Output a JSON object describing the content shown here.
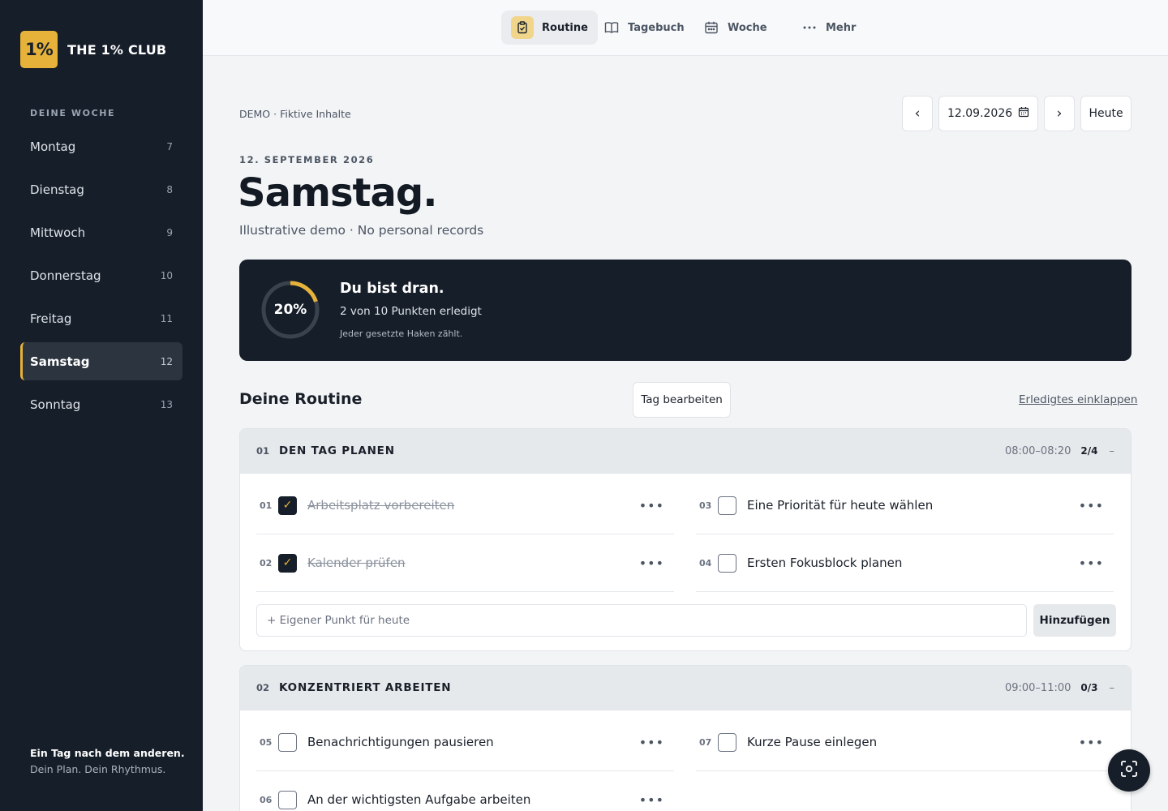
{
  "brand": {
    "logo": "1%",
    "name": "THE 1% CLUB"
  },
  "sidebar": {
    "heading": "DEINE WOCHE",
    "days": [
      {
        "label": "Montag",
        "num": "7"
      },
      {
        "label": "Dienstag",
        "num": "8"
      },
      {
        "label": "Mittwoch",
        "num": "9"
      },
      {
        "label": "Donnerstag",
        "num": "10"
      },
      {
        "label": "Freitag",
        "num": "11"
      },
      {
        "label": "Samstag",
        "num": "12",
        "active": true
      },
      {
        "label": "Sonntag",
        "num": "13"
      }
    ],
    "footer": {
      "line1": "Ein Tag nach dem anderen.",
      "line2": "Dein Plan. Dein Rhythmus."
    }
  },
  "nav": {
    "tabs": [
      {
        "label": "Routine",
        "icon": "clipboard-check-icon",
        "active": true
      },
      {
        "label": "Tagebuch",
        "icon": "book-icon"
      },
      {
        "label": "Woche",
        "icon": "calendar-icon"
      },
      {
        "label": "Mehr",
        "icon": "more-dots-icon"
      }
    ]
  },
  "main": {
    "demo_note": "DEMO · Fiktive Inhalte",
    "date_picker": {
      "prev": "‹",
      "value": "12.09.2026",
      "next": "›",
      "today": "Heute"
    },
    "date_label": "12. SEPTEMBER 2026",
    "title": "Samstag.",
    "subtitle": "Illustrative demo · No personal records",
    "progress": {
      "percent_label": "20%",
      "fraction": 0.2,
      "title": "Du bist dran.",
      "subtitle": "2 von 10 Punkten erledigt",
      "note": "Jeder gesetzte Haken zählt."
    },
    "routine": {
      "heading": "Deine Routine",
      "edit_label": "Tag bearbeiten",
      "collapse_label": "Erledigtes einklappen",
      "sections": [
        {
          "num": "01",
          "title": "DEN TAG PLANEN",
          "time": "08:00–08:20",
          "count": "2/4",
          "toggle": "–",
          "tasks": [
            {
              "num": "01",
              "label": "Arbeitsplatz vorbereiten",
              "done": true
            },
            {
              "num": "02",
              "label": "Kalender prüfen",
              "done": true
            },
            {
              "num": "03",
              "label": "Eine Priorität für heute wählen",
              "done": false
            },
            {
              "num": "04",
              "label": "Ersten Fokusblock planen",
              "done": false
            }
          ],
          "add": {
            "placeholder": "+ Eigener Punkt für heute",
            "button": "Hinzufügen"
          }
        },
        {
          "num": "02",
          "title": "KONZENTRIERT ARBEITEN",
          "time": "09:00–11:00",
          "count": "0/3",
          "toggle": "–",
          "tasks": [
            {
              "num": "05",
              "label": "Benachrichtigungen pausieren",
              "done": false
            },
            {
              "num": "06",
              "label": "An der wichtigsten Aufgabe arbeiten",
              "done": false
            },
            {
              "num": "07",
              "label": "Kurze Pause einlegen",
              "done": false
            }
          ]
        }
      ]
    }
  },
  "fab": {
    "icon": "focus-scan-icon"
  },
  "colors": {
    "accent": "#e6b23a",
    "dark": "#161e29",
    "background": "#f3f4f6"
  }
}
